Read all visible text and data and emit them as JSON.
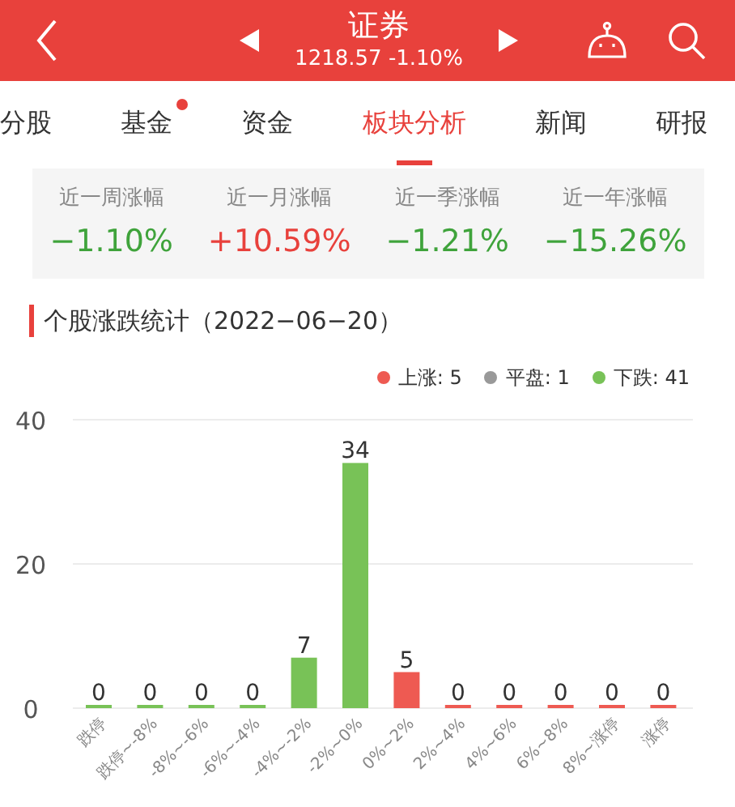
{
  "header": {
    "title": "证券",
    "subtitle": "1218.57 -1.10%"
  },
  "tabs": [
    {
      "label": "分股",
      "selected": false,
      "dot": false
    },
    {
      "label": "基金",
      "selected": false,
      "dot": true
    },
    {
      "label": "资金",
      "selected": false,
      "dot": false
    },
    {
      "label": "板块分析",
      "selected": true,
      "dot": false
    },
    {
      "label": "新闻",
      "selected": false,
      "dot": false
    },
    {
      "label": "研报",
      "selected": false,
      "dot": false
    }
  ],
  "stats": [
    {
      "label": "近一周涨幅",
      "value": "−1.10%",
      "kind": "down"
    },
    {
      "label": "近一月涨幅",
      "value": "+10.59%",
      "kind": "up"
    },
    {
      "label": "近一季涨幅",
      "value": "−1.21%",
      "kind": "down"
    },
    {
      "label": "近一年涨幅",
      "value": "−15.26%",
      "kind": "down"
    }
  ],
  "section_title": "个股涨跌统计（2022−06−20）",
  "legend": [
    {
      "count": ": 5"
    },
    {
      "count": ": 1"
    },
    {
      "count": ": 41"
    }
  ],
  "chart_data": {
    "type": "bar",
    "stacked": true,
    "data_labels": true,
    "ylim": [
      0,
      40
    ],
    "yticks": [
      0,
      20,
      40
    ],
    "categories": [
      "跌停",
      "跌停~-8%",
      "-8%~-6%",
      "-6%~-4%",
      "-4%~-2%",
      "-2%~0%",
      "0%~2%",
      "2%~4%",
      "4%~6%",
      "6%~8%",
      "8%~涨停",
      "涨停"
    ],
    "series": [
      {
        "name": "上涨",
        "color": "#ee5a52",
        "values": [
          null,
          null,
          null,
          null,
          null,
          null,
          5,
          0,
          0,
          0,
          0,
          0
        ]
      },
      {
        "name": "平盘",
        "color": "#999999",
        "values": [
          null,
          null,
          null,
          null,
          null,
          null,
          null,
          null,
          null,
          null,
          null,
          null
        ]
      },
      {
        "name": "下跌",
        "color": "#78c257",
        "values": [
          0,
          0,
          0,
          0,
          7,
          34,
          null,
          null,
          null,
          null,
          null,
          null
        ]
      }
    ]
  }
}
